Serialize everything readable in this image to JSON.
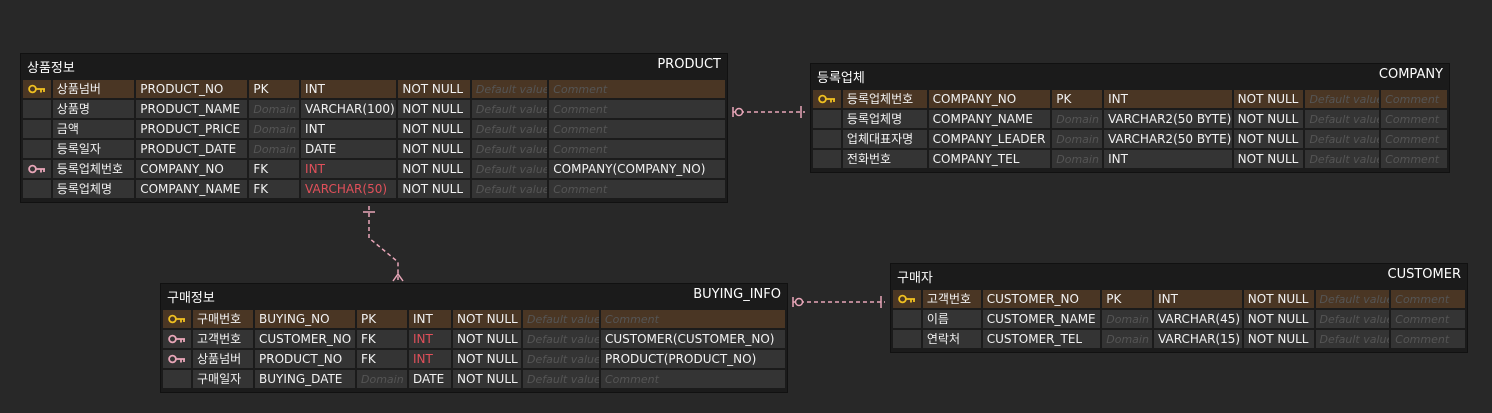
{
  "colors": {
    "background": "#282828",
    "pk_row": "#4a3624",
    "row": "#343434",
    "fk_type": "#e0505a",
    "relation": "#e8a6b8",
    "pk_key": "#f0c020",
    "fk_key": "#e8a6b8"
  },
  "placeholders": {
    "domain": "Domain",
    "default": "Default value",
    "comment": "Comment"
  },
  "tables": {
    "product": {
      "logical": "상품정보",
      "physical": "PRODUCT",
      "columns": [
        {
          "icon": "pk-key-icon",
          "logical": "상품넘버",
          "physical": "PRODUCT_NO",
          "key": "PK",
          "type": "INT",
          "nn": "NOT NULL",
          "comment": ""
        },
        {
          "icon": "",
          "logical": "상품명",
          "physical": "PRODUCT_NAME",
          "key": "",
          "type": "VARCHAR(100)",
          "nn": "NOT NULL",
          "comment": ""
        },
        {
          "icon": "",
          "logical": "금액",
          "physical": "PRODUCT_PRICE",
          "key": "",
          "type": "INT",
          "nn": "NOT NULL",
          "comment": ""
        },
        {
          "icon": "",
          "logical": "등록일자",
          "physical": "PRODUCT_DATE",
          "key": "",
          "type": "DATE",
          "nn": "NOT NULL",
          "comment": ""
        },
        {
          "icon": "fk-key-icon",
          "logical": "등록업체번호",
          "physical": "COMPANY_NO",
          "key": "FK",
          "type": "INT",
          "nn": "NOT NULL",
          "comment": "COMPANY(COMPANY_NO)"
        },
        {
          "icon": "",
          "logical": "등록업체명",
          "physical": "COMPANY_NAME",
          "key": "FK",
          "type": "VARCHAR(50)",
          "nn": "NOT NULL",
          "comment": ""
        }
      ]
    },
    "company": {
      "logical": "등록업체",
      "physical": "COMPANY",
      "columns": [
        {
          "icon": "pk-key-icon",
          "logical": "등록업체번호",
          "physical": "COMPANY_NO",
          "key": "PK",
          "type": "INT",
          "nn": "NOT NULL",
          "comment": ""
        },
        {
          "icon": "",
          "logical": "등록업체명",
          "physical": "COMPANY_NAME",
          "key": "",
          "type": "VARCHAR2(50 BYTE)",
          "nn": "NOT NULL",
          "comment": ""
        },
        {
          "icon": "",
          "logical": "업체대표자명",
          "physical": "COMPANY_LEADER",
          "key": "",
          "type": "VARCHAR2(50 BYTE)",
          "nn": "NOT NULL",
          "comment": ""
        },
        {
          "icon": "",
          "logical": "전화번호",
          "physical": "COMPANY_TEL",
          "key": "",
          "type": "INT",
          "nn": "NOT NULL",
          "comment": ""
        }
      ]
    },
    "buying_info": {
      "logical": "구매정보",
      "physical": "BUYING_INFO",
      "columns": [
        {
          "icon": "pk-key-icon",
          "logical": "구매번호",
          "physical": "BUYING_NO",
          "key": "PK",
          "type": "INT",
          "nn": "NOT NULL",
          "comment": ""
        },
        {
          "icon": "fk-key-icon",
          "logical": "고객번호",
          "physical": "CUSTOMER_NO",
          "key": "FK",
          "type": "INT",
          "nn": "NOT NULL",
          "comment": "CUSTOMER(CUSTOMER_NO)"
        },
        {
          "icon": "fk-key-icon",
          "logical": "상품넘버",
          "physical": "PRODUCT_NO",
          "key": "FK",
          "type": "INT",
          "nn": "NOT NULL",
          "comment": "PRODUCT(PRODUCT_NO)"
        },
        {
          "icon": "",
          "logical": "구매일자",
          "physical": "BUYING_DATE",
          "key": "",
          "type": "DATE",
          "nn": "NOT NULL",
          "comment": ""
        }
      ]
    },
    "customer": {
      "logical": "구매자",
      "physical": "CUSTOMER",
      "columns": [
        {
          "icon": "pk-key-icon",
          "logical": "고객번호",
          "physical": "CUSTOMER_NO",
          "key": "PK",
          "type": "INT",
          "nn": "NOT NULL",
          "comment": ""
        },
        {
          "icon": "",
          "logical": "이름",
          "physical": "CUSTOMER_NAME",
          "key": "",
          "type": "VARCHAR(45)",
          "nn": "NOT NULL",
          "comment": ""
        },
        {
          "icon": "",
          "logical": "연락처",
          "physical": "CUSTOMER_TEL",
          "key": "",
          "type": "VARCHAR(15)",
          "nn": "NOT NULL",
          "comment": ""
        }
      ]
    }
  }
}
